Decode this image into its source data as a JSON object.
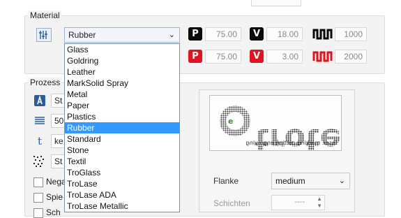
{
  "material_group": {
    "legend": "Material",
    "selected": "Rubber",
    "options": [
      "Glass",
      "Goldring",
      "Leather",
      "MarkSolid Spray",
      "Metal",
      "Paper",
      "Plastics",
      "Rubber",
      "Standard",
      "Stone",
      "Textil",
      "TroGlass",
      "TroLase",
      "TroLase ADA",
      "TroLase Metallic"
    ],
    "row1": {
      "power": "75.00",
      "velocity": "18.00",
      "frequency": "1000"
    },
    "row2": {
      "power": "75.00",
      "velocity": "3.00",
      "frequency": "2000"
    }
  },
  "process_group": {
    "legend_partial": "Prozess",
    "left_fields": [
      "St",
      "50",
      "ke",
      "St"
    ],
    "checkboxes": [
      "Nega",
      "Spie",
      "Sch"
    ]
  },
  "preview": {
    "flanke_label": "Flanke",
    "flanke_value": "medium",
    "schichten_label": "Schichten",
    "schichten_value": "----"
  },
  "badges": {
    "power": "P",
    "velocity": "V"
  },
  "colors": {
    "selection": "#3399ff",
    "badge_red": "#e0141e",
    "badge_black": "#0a0a0a"
  }
}
